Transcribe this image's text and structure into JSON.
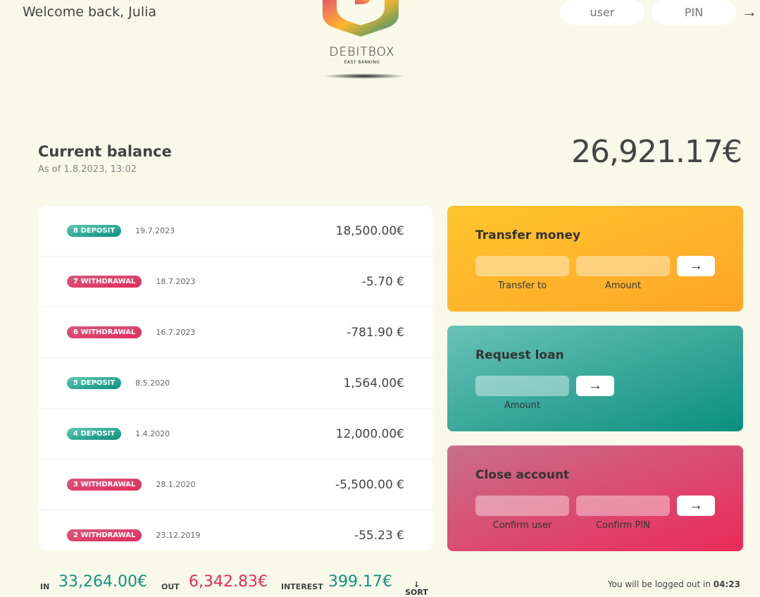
{
  "nav": {
    "welcome": "Welcome back, Julia",
    "logo_name": "DEBITBOX",
    "logo_tagline": "EASY BANKING",
    "user_placeholder": "user",
    "pin_placeholder": "PIN",
    "login_arrow": "→"
  },
  "balance": {
    "label": "Current balance",
    "date_text": "As of 1.8.2023, 13:02",
    "value": "26,921.17€"
  },
  "movements": [
    {
      "type_label": "8 DEPOSIT",
      "kind": "deposit",
      "date": "19.7.2023",
      "value": "18,500.00€"
    },
    {
      "type_label": "7 WITHDRAWAL",
      "kind": "withdrawal",
      "date": "18.7.2023",
      "value": "-5.70 €"
    },
    {
      "type_label": "6 WITHDRAWAL",
      "kind": "withdrawal",
      "date": "16.7.2023",
      "value": "-781.90 €"
    },
    {
      "type_label": "5 DEPOSIT",
      "kind": "deposit",
      "date": "8.5.2020",
      "value": "1,564.00€"
    },
    {
      "type_label": "4 DEPOSIT",
      "kind": "deposit",
      "date": "1.4.2020",
      "value": "12,000.00€"
    },
    {
      "type_label": "3 WITHDRAWAL",
      "kind": "withdrawal",
      "date": "28.1.2020",
      "value": "-5,500.00 €"
    },
    {
      "type_label": "2 WITHDRAWAL",
      "kind": "withdrawal",
      "date": "23.12.2019",
      "value": "-55.23 €"
    }
  ],
  "operations": {
    "transfer": {
      "title": "Transfer money",
      "to_label": "Transfer to",
      "amount_label": "Amount",
      "button": "→"
    },
    "loan": {
      "title": "Request loan",
      "amount_label": "Amount",
      "button": "→"
    },
    "close": {
      "title": "Close account",
      "user_label": "Confirm user",
      "pin_label": "Confirm PIN",
      "button": "→"
    }
  },
  "summary": {
    "in_label": "IN",
    "in_value": "33,264.00€",
    "out_label": "OUT",
    "out_value": "6,342.83€",
    "interest_label": "INTEREST",
    "interest_value": "399.17€",
    "sort_arrow": "↓",
    "sort_label": "SORT"
  },
  "logout": {
    "text": "You will be logged out in ",
    "timer": "04:23"
  },
  "colors": {
    "background": "#f8f9e9",
    "deposit": "#0a8f7f",
    "withdrawal": "#e52a5a",
    "transfer_card": "#ffb52a",
    "loan_card": "#2ba596",
    "close_card": "#e04a70"
  },
  "icons": {
    "logo": "debitbox-shield-logo",
    "login": "arrow-right-icon"
  }
}
